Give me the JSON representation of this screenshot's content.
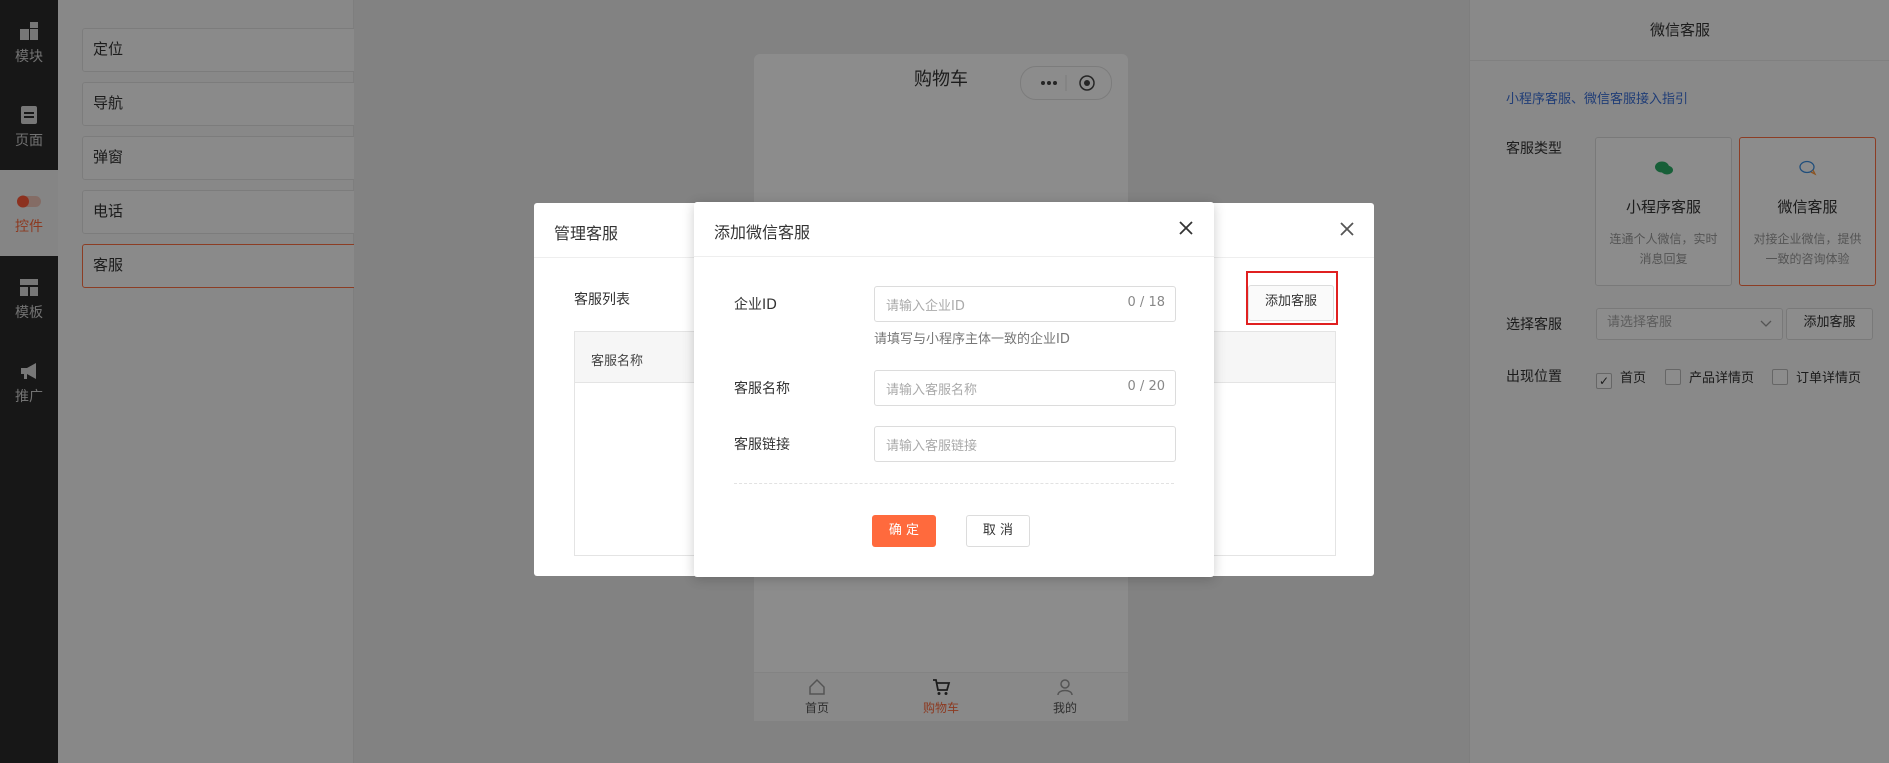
{
  "rail": {
    "items": [
      {
        "label": "模块",
        "icon": "blocks-icon"
      },
      {
        "label": "页面",
        "icon": "page-icon"
      },
      {
        "label": "控件",
        "icon": "toggle-icon"
      },
      {
        "label": "模板",
        "icon": "template-icon"
      },
      {
        "label": "推广",
        "icon": "megaphone-icon"
      }
    ]
  },
  "components": {
    "items": [
      {
        "label": "定位"
      },
      {
        "label": "导航"
      },
      {
        "label": "弹窗"
      },
      {
        "label": "电话"
      },
      {
        "label": "客服"
      }
    ]
  },
  "phone": {
    "title": "购物车",
    "tabs": [
      {
        "label": "首页"
      },
      {
        "label": "购物车"
      },
      {
        "label": "我的"
      }
    ]
  },
  "settings": {
    "title": "微信客服",
    "guide_link": "小程序客服、微信客服接入指引",
    "type_label": "客服类型",
    "types": [
      {
        "title": "小程序客服",
        "desc": "连通个人微信，实时消息回复"
      },
      {
        "title": "微信客服",
        "desc": "对接企业微信，提供一致的咨询体验"
      }
    ],
    "select_label": "选择客服",
    "select_placeholder": "请选择客服",
    "add_button": "添加客服",
    "position_label": "出现位置",
    "positions": [
      {
        "label": "首页",
        "checked": true
      },
      {
        "label": "产品详情页",
        "checked": false
      },
      {
        "label": "订单详情页",
        "checked": false
      }
    ]
  },
  "manage_dialog": {
    "title": "管理客服",
    "list_label": "客服列表",
    "add_button": "添加客服",
    "table_header": "客服名称"
  },
  "add_dialog": {
    "title": "添加微信客服",
    "corp_id": {
      "label": "企业ID",
      "placeholder": "请输入企业ID",
      "counter": "0 / 18",
      "hint": "请填写与小程序主体一致的企业ID"
    },
    "name": {
      "label": "客服名称",
      "placeholder": "请输入客服名称",
      "counter": "0 / 20"
    },
    "link": {
      "label": "客服链接",
      "placeholder": "请输入客服链接"
    },
    "ok": "确 定",
    "cancel": "取 消"
  },
  "colors": {
    "accent": "#ff6a3d",
    "highlight": "#e02020",
    "link": "#3b6fd8"
  }
}
